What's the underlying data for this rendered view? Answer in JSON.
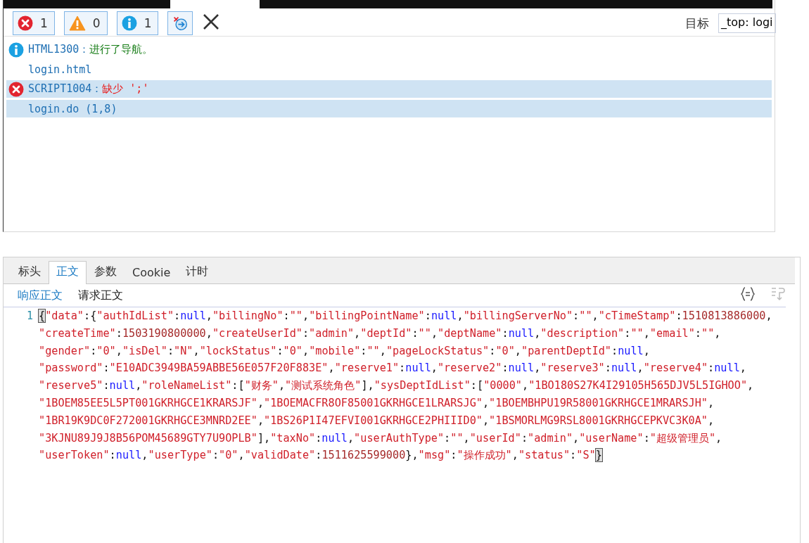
{
  "console_toolbar": {
    "filters": [
      {
        "kind": "error",
        "count": "1",
        "on": true
      },
      {
        "kind": "warning",
        "count": "0",
        "on": true
      },
      {
        "kind": "info",
        "count": "1",
        "on": true
      }
    ],
    "clear_on_navigate": true,
    "target_label": "目标",
    "target_value": "_top: logi"
  },
  "console_messages": [
    {
      "kind": "info",
      "code": "HTML1300：",
      "message": "进行了导航。",
      "source": "login.html",
      "selected": false
    },
    {
      "kind": "error",
      "code": "SCRIPT1004：",
      "message": "缺少 ';'",
      "source": "login.do (1,8)",
      "selected": true
    }
  ],
  "detail_tabs": [
    {
      "label": "标头",
      "selected": false
    },
    {
      "label": "正文",
      "selected": true
    },
    {
      "label": "参数",
      "selected": false
    },
    {
      "label": "Cookie",
      "selected": false
    },
    {
      "label": "计时",
      "selected": false
    }
  ],
  "body_tabs": [
    {
      "label": "响应正文",
      "selected": true
    },
    {
      "label": "请求正文",
      "selected": false
    }
  ],
  "response_body": {
    "line_number": "1",
    "lines": [
      "{\"data\":{\"authIdList\":null,\"billingNo\":\"\",\"billingPointName\":null,\"billingServerNo\":\"\",\"cTimeStamp\":1510813886000,",
      "\"createTime\":1503190800000,\"createUserId\":\"admin\",\"deptId\":\"\",\"deptName\":null,\"description\":\"\",\"email\":\"\",",
      "\"gender\":\"0\",\"isDel\":\"N\",\"lockStatus\":\"0\",\"mobile\":\"\",\"pageLockStatus\":\"0\",\"parentDeptId\":null,",
      "\"password\":\"E10ADC3949BA59ABBE56E057F20F883E\",\"reserve1\":null,\"reserve2\":null,\"reserve3\":null,\"reserve4\":null,",
      "\"reserve5\":null,\"roleNameList\":[\"财务\",\"测试系统角色\"],\"sysDeptIdList\":[\"0000\",\"1BO180S27K4I29105H565DJV5L5IGHOO\",",
      "\"1BOEM85EE5L5PT001GKRHGCE1KRARSJF\",\"1BOEMACFR8OF85001GKRHGCE1LRARSJG\",\"1BOEMBHPU19R58001GKRHGCE1MRARSJH\",",
      "\"1BR19K9DC0F272001GKRHGCE3MNRD2EE\",\"1BS26P1I47EFVI001GKRHGCE2PHIIID0\",\"1BSMORLMG9RSL8001GKRHGCEPKVC3K0A\",",
      "\"3KJNU89J9J8B56POM45689GTY7U9OPLB\"],\"taxNo\":null,\"userAuthType\":\"\",\"userId\":\"admin\",\"userName\":\"超级管理员\",",
      "\"userToken\":null,\"userType\":\"0\",\"validDate\":1511625599000},\"msg\":\"操作成功\",\"status\":\"S\"}"
    ]
  }
}
